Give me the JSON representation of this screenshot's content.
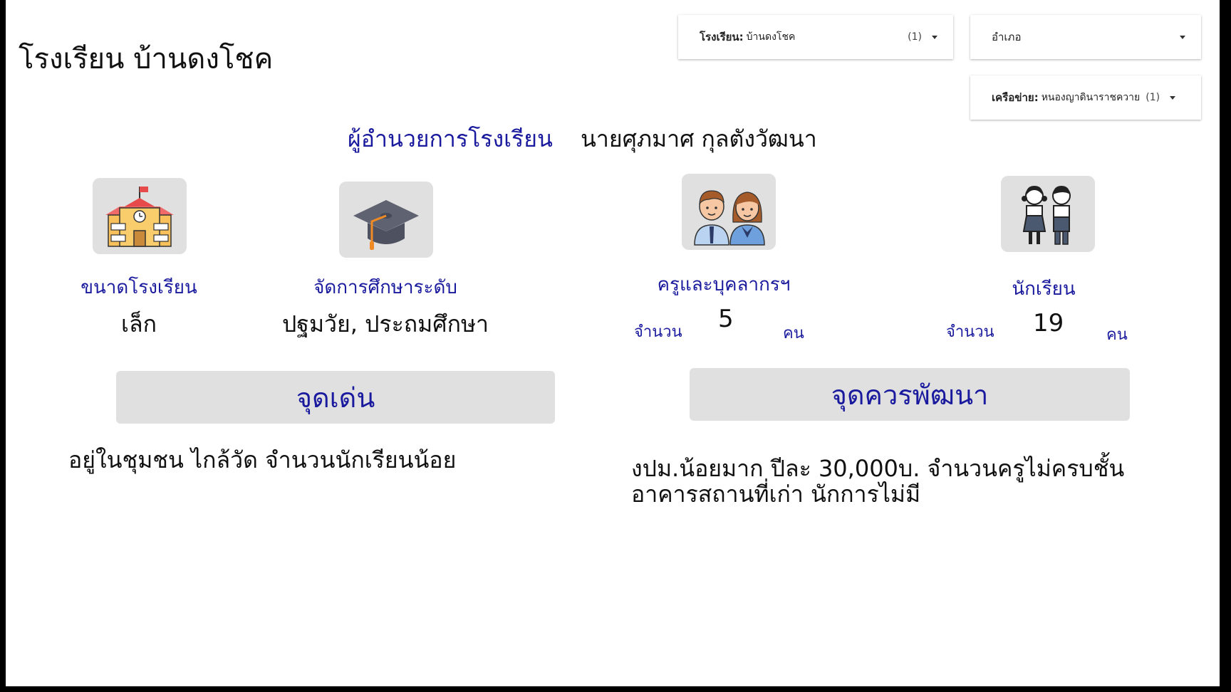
{
  "school_title": "โรงเรียน บ้านดงโชค",
  "filters": {
    "school": {
      "label": "โรงเรียน:",
      "value": "บ้านดงโชค",
      "count": "(1)"
    },
    "district": {
      "label": "อำเภอ"
    },
    "network": {
      "label": "เครือข่าย:",
      "value": "หนองญาดินาราชควาย",
      "count": "(1)"
    }
  },
  "director": {
    "label": "ผู้อำนวยการโรงเรียน",
    "name": "นายศุภมาศ กุลตังวัฒนา"
  },
  "stats": {
    "school_size": {
      "label": "ขนาดโรงเรียน",
      "value": "เล็ก",
      "icon": "school-building-icon"
    },
    "education_level": {
      "label": "จัดการศึกษาระดับ",
      "value": "ปฐมวัย, ประถมศึกษา",
      "icon": "graduation-cap-icon"
    },
    "staff": {
      "label": "ครูและบุคลากรฯ",
      "count_label": "จำนวน",
      "count": "5",
      "unit": "คน",
      "icon": "teachers-icon"
    },
    "students": {
      "label": "นักเรียน",
      "count_label": "จำนวน",
      "count": "19",
      "unit": "คน",
      "icon": "students-icon"
    }
  },
  "strengths": {
    "title": "จุดเด่น",
    "text": "อยู่ในชุมชน ไกล้วัด จำนวนนักเรียนน้อย"
  },
  "improvements": {
    "title": "จุดควรพัฒนา",
    "text": "งปม.น้อยมาก ปีละ 30,000บ. จำนวนครูไม่ครบชั้น อาคารสถานที่เก่า นักการไม่มี"
  },
  "colors": {
    "accent": "#1a1a9e",
    "tile": "#e0e0e0"
  }
}
